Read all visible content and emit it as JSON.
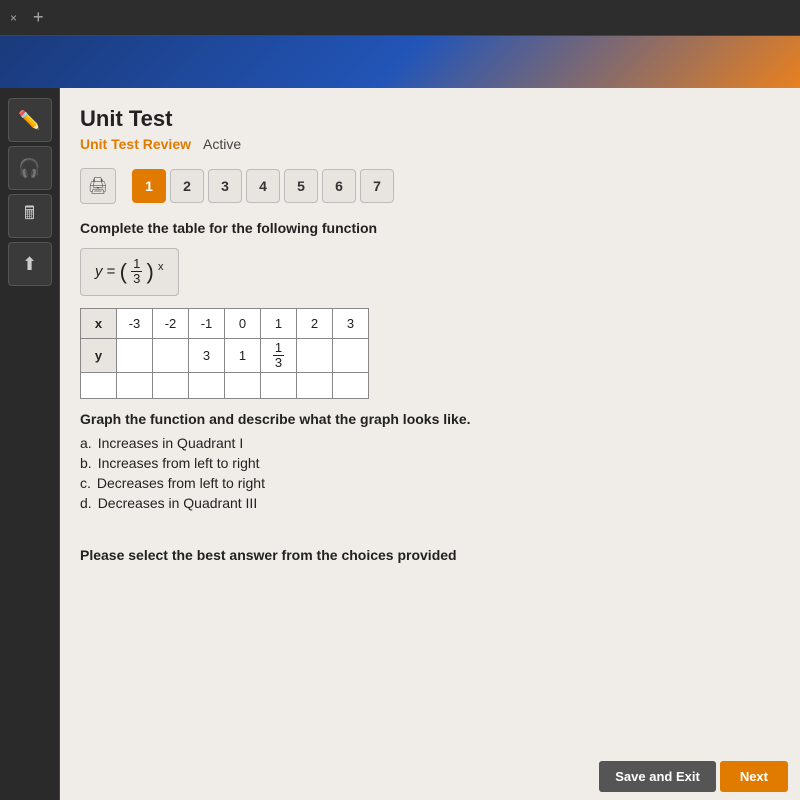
{
  "browser": {
    "tab_label": "×",
    "tab_add": "+"
  },
  "header": {
    "title": "Unit Test",
    "breadcrumb_link": "Unit Test Review",
    "status": "Active"
  },
  "navigation": {
    "questions": [
      "1",
      "2",
      "3",
      "4",
      "5",
      "6",
      "7"
    ],
    "active_question": 1
  },
  "question": {
    "instruction": "Complete the table for the following function",
    "formula": "y = (1/3)^x",
    "table": {
      "headers": [
        "x",
        "-3",
        "-2",
        "-1",
        "0",
        "1",
        "2",
        "3"
      ],
      "y_values": [
        "y",
        "",
        "",
        "3",
        "1",
        "1/3",
        "",
        ""
      ]
    },
    "graph_instruction": "Graph the function and describe what the graph looks like.",
    "choices": [
      {
        "letter": "a.",
        "text": "Increases in Quadrant I"
      },
      {
        "letter": "b.",
        "text": "Increases from left to right"
      },
      {
        "letter": "c.",
        "text": "Decreases from left to right"
      },
      {
        "letter": "d.",
        "text": "Decreases in Quadrant III"
      }
    ],
    "select_instruction": "Please select the best answer from the choices provided"
  },
  "buttons": {
    "save_exit": "Save and Exit",
    "next": "Next"
  },
  "icons": {
    "pencil": "✏",
    "headset": "🎧",
    "calculator": "🖩",
    "arrow_up": "⬆",
    "print": "🖨"
  }
}
